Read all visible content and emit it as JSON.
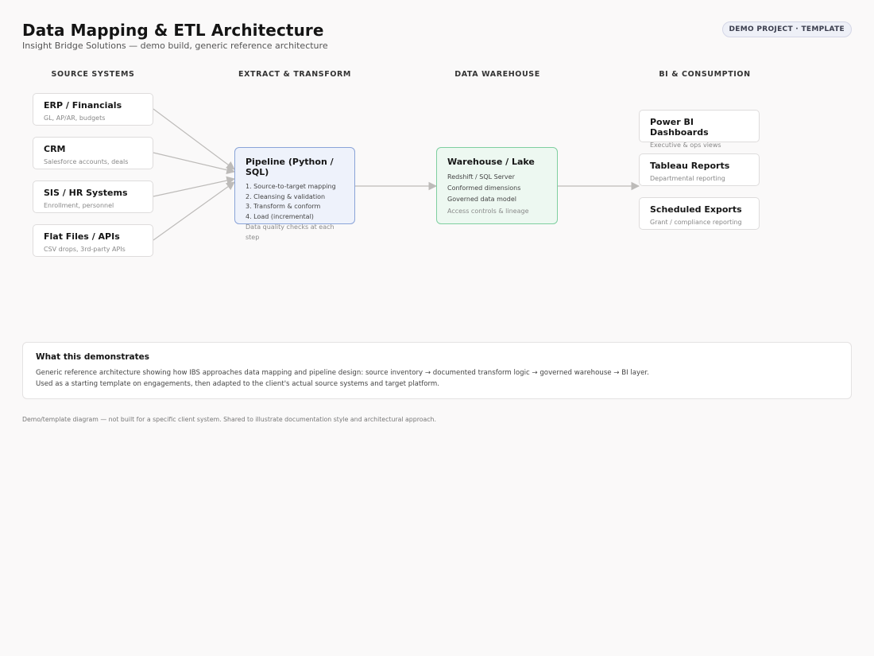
{
  "header": {
    "title": "Data Mapping & ETL Architecture",
    "subtitle": "Insight Bridge Solutions — demo build, generic reference architecture",
    "badge": "DEMO PROJECT · TEMPLATE"
  },
  "columns": {
    "sources": "SOURCE SYSTEMS",
    "extract": "EXTRACT & TRANSFORM",
    "warehouse": "DATA WAREHOUSE",
    "bi": "BI & CONSUMPTION"
  },
  "sources": [
    {
      "name": "ERP / Financials",
      "desc": "GL, AP/AR, budgets"
    },
    {
      "name": "CRM",
      "desc": "Salesforce accounts, deals"
    },
    {
      "name": "SIS / HR Systems",
      "desc": "Enrollment, personnel"
    },
    {
      "name": "Flat Files / APIs",
      "desc": "CSV drops, 3rd-party APIs"
    }
  ],
  "pipeline": {
    "name": "Pipeline (Python / SQL)",
    "steps": [
      "1. Source-to-target mapping",
      "2. Cleansing & validation",
      "3. Transform & conform",
      "4. Load (incremental)"
    ],
    "note": "Data quality checks at each step"
  },
  "warehouse": {
    "name": "Warehouse / Lake",
    "items": [
      "Redshift / SQL Server",
      "Conformed dimensions",
      "Governed data model"
    ],
    "note": "Access controls & lineage"
  },
  "outputs": [
    {
      "name": "Power BI Dashboards",
      "desc": "Executive & ops views"
    },
    {
      "name": "Tableau Reports",
      "desc": "Departmental reporting"
    },
    {
      "name": "Scheduled Exports",
      "desc": "Grant / compliance reporting"
    }
  ],
  "demonstrates": {
    "heading": "What this demonstrates",
    "line1": "Generic reference architecture showing how IBS approaches data mapping and pipeline design: source inventory → documented transform logic → governed warehouse → BI layer.",
    "line2": "Used as a starting template on engagements, then adapted to the client's actual source systems and target platform."
  },
  "footer": "Demo/template diagram — not built for a specific client system. Shared to illustrate documentation style and architectural approach.",
  "colors": {
    "pipeline_border": "#8aa4d8",
    "pipeline_fill": "#eef2fb",
    "warehouse_border": "#7fcfa0",
    "warehouse_fill": "#edf8f1",
    "arrow": "#bdbbb9"
  }
}
